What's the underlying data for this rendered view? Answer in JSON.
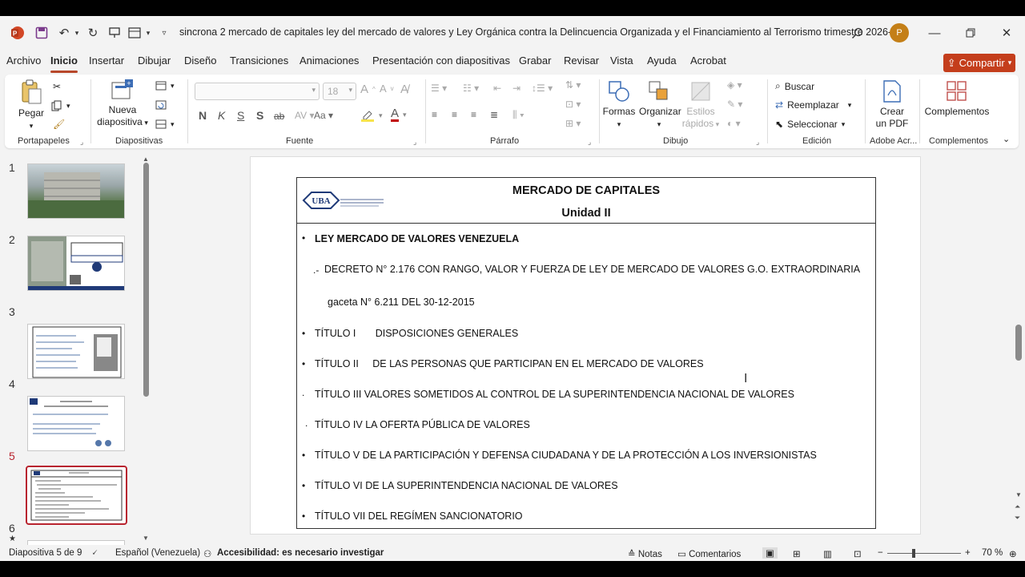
{
  "titlebar": {
    "doc_title": "sincrona 2 mercado de capitales  ley del mercado de valores y Ley Orgánica contra la Delincuencia Organizada y el Financiamiento al Terrorismo trimestre 2026-1...",
    "avatar_initial": "P"
  },
  "menu": {
    "tabs": [
      "Archivo",
      "Inicio",
      "Insertar",
      "Dibujar",
      "Diseño",
      "Transiciones",
      "Animaciones",
      "Presentación con diapositivas",
      "Grabar",
      "Revisar",
      "Vista",
      "Ayuda",
      "Acrobat"
    ],
    "share_label": "Compartir"
  },
  "ribbon": {
    "portapapeles": {
      "paste": "Pegar",
      "label": "Portapapeles"
    },
    "diapositivas": {
      "new_line1": "Nueva",
      "new_line2": "diapositiva",
      "label": "Diapositivas"
    },
    "fuente": {
      "size": "18",
      "bold": "N",
      "italic": "K",
      "underline": "S",
      "shadow": "S",
      "strike": "ab",
      "label": "Fuente"
    },
    "parrafo": {
      "label": "Párrafo"
    },
    "dibujo": {
      "shapes": "Formas",
      "arrange": "Organizar",
      "styles_line1": "Estilos",
      "styles_line2": "rápidos",
      "label": "Dibujo"
    },
    "edicion": {
      "find": "Buscar",
      "replace": "Reemplazar",
      "select": "Seleccionar",
      "label": "Edición"
    },
    "adobe": {
      "line1": "Crear",
      "line2": "un PDF",
      "label": "Adobe Acr..."
    },
    "complementos": {
      "button": "Complementos",
      "label": "Complementos"
    }
  },
  "thumbnails": {
    "numbers": [
      "1",
      "2",
      "3",
      "4",
      "5",
      "6"
    ],
    "selected": "5"
  },
  "slide": {
    "title": "MERCADO DE CAPITALES",
    "subtitle": "Unidad II",
    "rows": [
      {
        "bullet": "•",
        "text": "LEY MERCADO DE VALORES VENEZUELA"
      },
      {
        "bullet": ".-",
        "text": "DECRETO N°  2.176 CON RANGO, VALOR Y FUERZA DE LEY DE MERCADO DE VALORES G.O. EXTRAORDINARIA"
      },
      {
        "bullet": "",
        "text": "gaceta  N° 6.211 DEL 30-12-2015"
      },
      {
        "bullet": "•",
        "text": "TÍTULO I       DISPOSICIONES GENERALES"
      },
      {
        "bullet": "•",
        "text": "TÍTULO II     DE LAS PERSONAS QUE PARTICIPAN EN EL MERCADO DE VALORES"
      },
      {
        "bullet": ".",
        "text": "TÍTULO III VALORES SOMETIDOS AL CONTROL DE LA SUPERINTENDENCIA NACIONAL DE VALORES"
      },
      {
        "bullet": ".",
        "text": "TÍTULO IV  LA OFERTA PÚBLICA DE VALORES"
      },
      {
        "bullet": "•",
        "text": "TÍTULO V  DE LA PARTICIPACIÓN Y DEFENSA CIUDADANA Y DE LA PROTECCIÓN A LOS INVERSIONISTAS"
      },
      {
        "bullet": "•",
        "text": "TÍTULO VI  DE LA SUPERINTENDENCIA NACIONAL DE VALORES"
      },
      {
        "bullet": "•",
        "text": "TÍTULO VII DEL REGÍMEN SANCIONATORIO"
      }
    ]
  },
  "status": {
    "slide_info": "Diapositiva 5 de 9",
    "language": "Español (Venezuela)",
    "accessibility": "Accesibilidad: es necesario investigar",
    "notes": "Notas",
    "comments": "Comentarios",
    "zoom": "70 %"
  },
  "colors": {
    "accent": "#b7472a",
    "share": "#c43e1c",
    "selected_thumb": "#b8242f"
  }
}
